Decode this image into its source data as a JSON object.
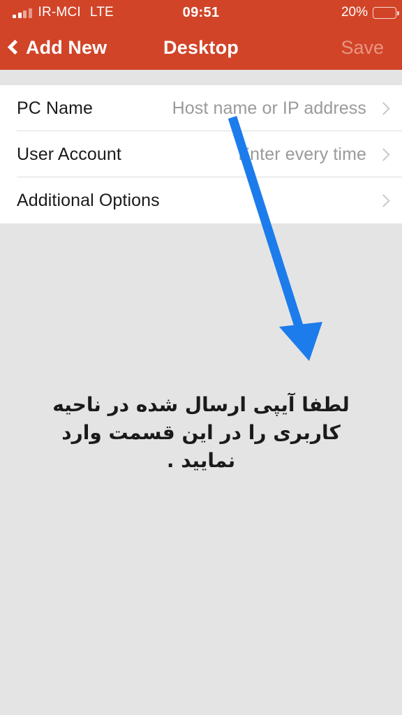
{
  "status_bar": {
    "signal_icon": "signal-bars-icon",
    "carrier": "IR-MCI",
    "network_type": "LTE",
    "time": "09:51",
    "battery_percent": "20%",
    "battery_level": 20,
    "battery_icon": "battery-low-icon",
    "battery_color": "#f3c13b"
  },
  "nav_bar": {
    "back_icon": "chevron-left-icon",
    "back_label": "Add New",
    "title": "Desktop",
    "save_label": "Save",
    "bar_color": "#d14428",
    "save_disabled_color": "#ea9582"
  },
  "settings_list": {
    "rows": [
      {
        "label": "PC Name",
        "value": "Host name or IP address",
        "disclosure_icon": "chevron-right-icon"
      },
      {
        "label": "User Account",
        "value": "Enter every time",
        "disclosure_icon": "chevron-right-icon"
      },
      {
        "label": "Additional Options",
        "value": "",
        "disclosure_icon": "chevron-right-icon"
      }
    ]
  },
  "annotation": {
    "arrow_icon": "arrow-down-right-icon",
    "arrow_color": "#1c7ceb",
    "note_line_1": "لطفا آیپی ارسال شده در ناحیه",
    "note_line_2": "کاربری را در این قسمت وارد نمایید ."
  }
}
